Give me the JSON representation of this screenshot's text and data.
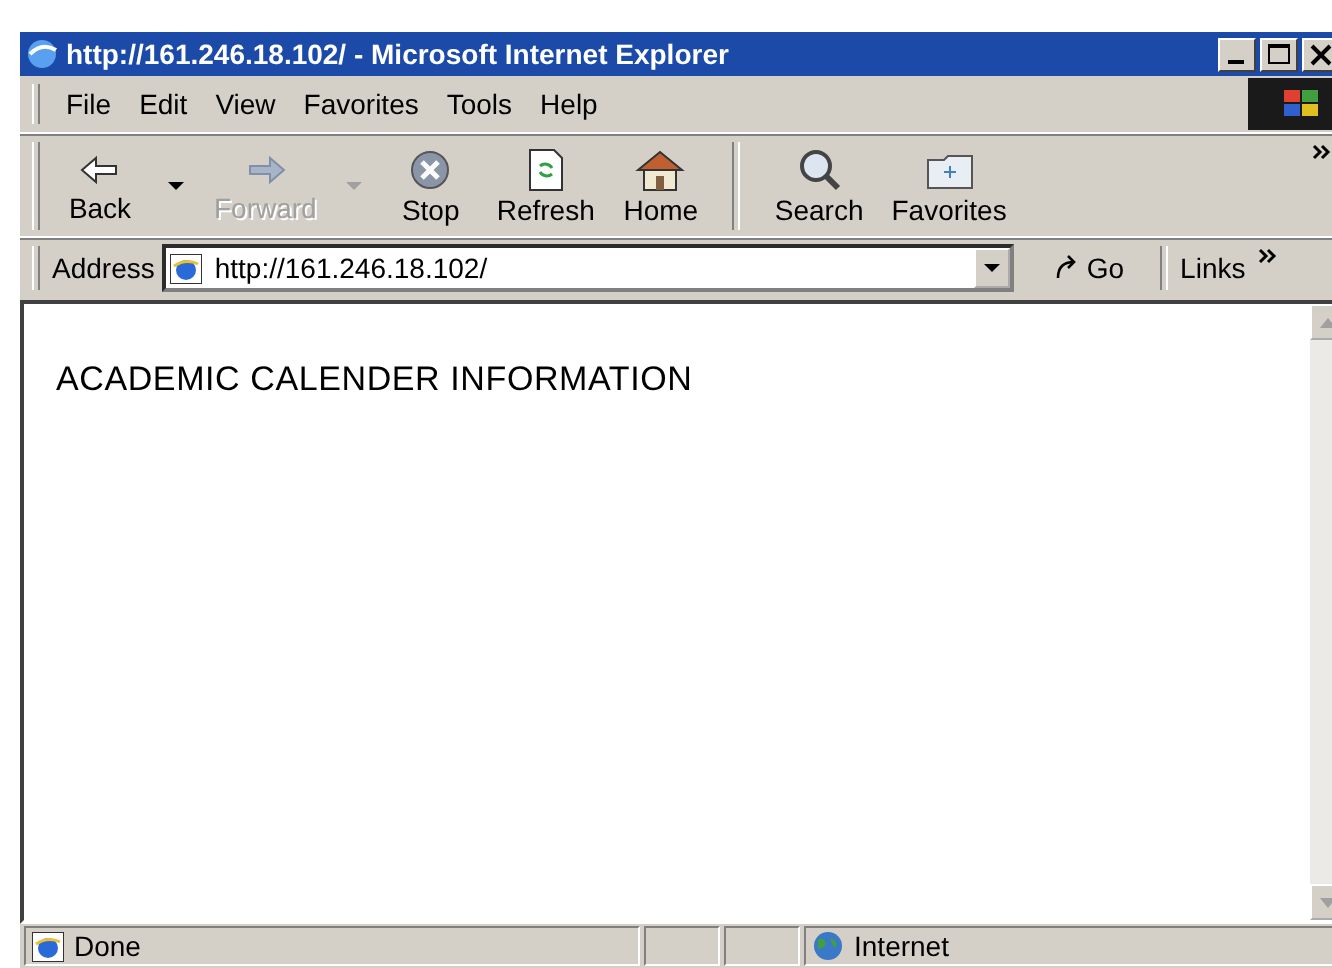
{
  "window": {
    "title": "http://161.246.18.102/ - Microsoft Internet Explorer"
  },
  "menu": [
    "File",
    "Edit",
    "View",
    "Favorites",
    "Tools",
    "Help"
  ],
  "toolbar": [
    {
      "label": "Back",
      "disabled": false,
      "dropdown": true
    },
    {
      "label": "Forward",
      "disabled": true,
      "dropdown": true
    },
    {
      "label": "Stop",
      "disabled": false,
      "dropdown": false
    },
    {
      "label": "Refresh",
      "disabled": false,
      "dropdown": false
    },
    {
      "label": "Home",
      "disabled": false,
      "dropdown": false
    },
    {
      "label": "Search",
      "disabled": false,
      "dropdown": false
    },
    {
      "label": "Favorites",
      "disabled": false,
      "dropdown": false
    }
  ],
  "address": {
    "label": "Address",
    "value": "http://161.246.18.102/",
    "go": "Go",
    "links": "Links"
  },
  "page": {
    "heading": "ACADEMIC CALENDER INFORMATION"
  },
  "status_bar": {
    "text": "Done",
    "zone": "Internet"
  }
}
